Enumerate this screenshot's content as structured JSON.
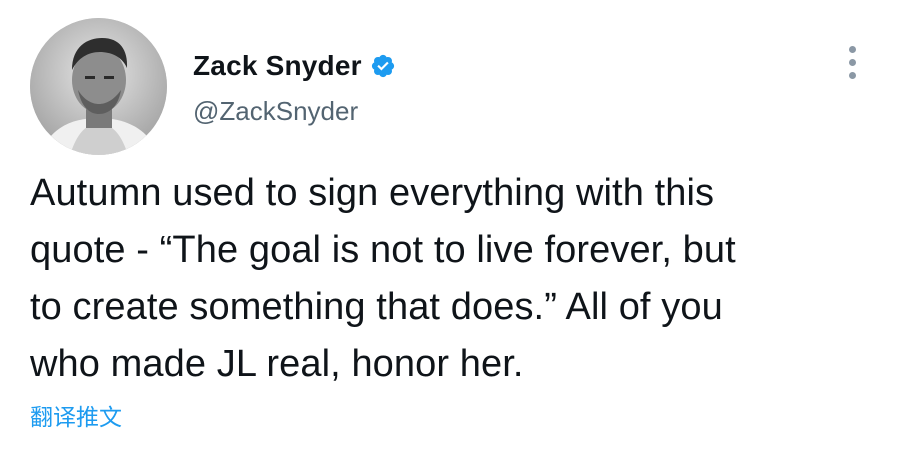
{
  "tweet": {
    "author": {
      "display_name": "Zack Snyder",
      "handle": "@ZackSnyder",
      "verified": true,
      "avatar_icon": "profile-photo"
    },
    "text": "Autumn used to sign everything with this\nquote - “The goal is not to live forever, but\nto create something that does.” All of you\nwho made JL real, honor her.",
    "translate_label": "翻译推文",
    "more_icon": "more-vertical-icon"
  },
  "colors": {
    "text_primary": "#0f1419",
    "text_secondary": "#536471",
    "accent_blue": "#1d9bf0",
    "background": "#ffffff"
  }
}
